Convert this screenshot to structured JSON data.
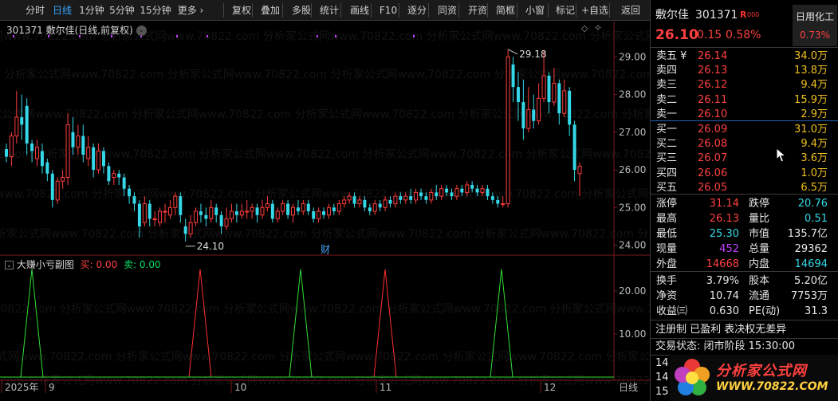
{
  "toolbar": {
    "items": [
      "分时",
      "日线",
      "1分钟",
      "5分钟",
      "15分钟",
      "更多 ›",
      "复权",
      "叠加",
      "多股",
      "统计",
      "画线",
      "F10",
      "逐分",
      "同资",
      "开资",
      "简框",
      "小窗",
      "标记",
      "+自选",
      "返回"
    ],
    "active_index": 1
  },
  "main_chart": {
    "title": "301371 敷尔佳(日线,前复权)",
    "high_label": "29.18",
    "low_label": "24.10",
    "event_label": "财",
    "y_ticks": [
      "29.00",
      "28.00",
      "27.00",
      "26.00",
      "25.00",
      "24.00"
    ],
    "watermark": "分析家公式网www.70822.com"
  },
  "sub_chart": {
    "title": "大赚小亏副图",
    "buy_label": "买: 0.00",
    "sell_label": "卖: 0.00",
    "y_ticks": [
      "20.00",
      "10.00"
    ]
  },
  "x_axis": {
    "labels": [
      "2025年",
      "9",
      "10",
      "11",
      "12"
    ],
    "period": "日线"
  },
  "colors": {
    "up": "#ff3c3c",
    "down": "#35d8e8",
    "buy_line": "#ff3030",
    "sell_line": "#30e030",
    "background": "#000000"
  },
  "chart_data": {
    "type": "candlestick",
    "ylim": [
      23.8,
      29.6
    ],
    "candles": [
      [
        26.55,
        26.35,
        26.7,
        26.2
      ],
      [
        26.35,
        26.9,
        27.0,
        26.1
      ],
      [
        26.9,
        27.4,
        28.1,
        26.7
      ],
      [
        27.4,
        27.2,
        28.0,
        26.8
      ],
      [
        27.7,
        26.7,
        27.9,
        26.4
      ],
      [
        26.7,
        26.5,
        26.8,
        26.2
      ],
      [
        26.3,
        26.6,
        26.8,
        26.1
      ],
      [
        26.5,
        26.1,
        26.7,
        25.9
      ],
      [
        26.2,
        25.9,
        26.3,
        25.7
      ],
      [
        25.9,
        25.2,
        26.0,
        25.0
      ],
      [
        25.2,
        25.7,
        25.8,
        25.1
      ],
      [
        25.7,
        25.8,
        26.0,
        25.5
      ],
      [
        25.8,
        27.2,
        27.5,
        25.6
      ],
      [
        27.0,
        26.6,
        27.4,
        26.4
      ],
      [
        26.6,
        26.9,
        27.2,
        26.4
      ],
      [
        26.9,
        26.4,
        27.2,
        26.2
      ],
      [
        26.3,
        26.6,
        26.9,
        26.1
      ],
      [
        26.6,
        26.0,
        26.7,
        25.8
      ],
      [
        26.0,
        26.5,
        26.7,
        25.9
      ],
      [
        26.5,
        26.1,
        26.6,
        25.9
      ],
      [
        26.1,
        25.7,
        26.2,
        25.6
      ],
      [
        25.8,
        25.9,
        26.0,
        25.6
      ],
      [
        25.9,
        25.8,
        26.0,
        25.6
      ],
      [
        25.8,
        25.5,
        25.9,
        25.3
      ],
      [
        25.5,
        25.3,
        25.6,
        25.1
      ],
      [
        25.3,
        25.1,
        25.4,
        24.9
      ],
      [
        25.1,
        24.5,
        25.2,
        24.2
      ],
      [
        24.6,
        25.1,
        25.3,
        24.5
      ],
      [
        25.1,
        24.7,
        25.2,
        24.5
      ],
      [
        24.7,
        24.7,
        24.9,
        24.5
      ],
      [
        24.6,
        24.9,
        25.0,
        24.5
      ],
      [
        24.9,
        24.9,
        25.1,
        24.6
      ],
      [
        24.8,
        25.0,
        25.2,
        24.7
      ],
      [
        25.0,
        25.3,
        25.4,
        24.8
      ],
      [
        25.3,
        24.8,
        25.4,
        24.6
      ],
      [
        24.5,
        24.3,
        24.7,
        24.1
      ],
      [
        24.3,
        24.6,
        24.8,
        24.2
      ],
      [
        24.6,
        24.9,
        25.0,
        24.5
      ],
      [
        24.9,
        24.8,
        25.1,
        24.6
      ],
      [
        24.8,
        24.7,
        25.0,
        24.5
      ],
      [
        24.7,
        25.0,
        25.2,
        24.6
      ],
      [
        25.0,
        24.8,
        25.1,
        24.6
      ],
      [
        24.8,
        24.5,
        24.9,
        24.3
      ],
      [
        24.5,
        24.7,
        25.0,
        24.4
      ],
      [
        24.7,
        24.9,
        25.1,
        24.6
      ],
      [
        24.9,
        24.8,
        25.1,
        24.6
      ],
      [
        24.8,
        24.9,
        25.1,
        24.7
      ],
      [
        24.9,
        24.9,
        25.2,
        24.7
      ],
      [
        24.9,
        25.0,
        25.1,
        24.7
      ],
      [
        25.0,
        24.8,
        25.1,
        24.6
      ],
      [
        24.8,
        25.0,
        25.2,
        24.7
      ],
      [
        25.0,
        25.1,
        25.3,
        24.9
      ],
      [
        25.1,
        24.7,
        25.2,
        24.6
      ],
      [
        24.7,
        24.9,
        25.0,
        24.6
      ],
      [
        24.9,
        25.1,
        25.2,
        24.8
      ],
      [
        25.1,
        24.8,
        25.2,
        24.7
      ],
      [
        24.8,
        25.0,
        25.1,
        24.6
      ],
      [
        25.0,
        24.9,
        25.2,
        24.8
      ],
      [
        24.9,
        25.1,
        25.2,
        24.8
      ],
      [
        25.1,
        24.9,
        25.2,
        24.8
      ],
      [
        24.9,
        24.7,
        25.0,
        24.6
      ],
      [
        24.7,
        24.9,
        25.0,
        24.6
      ],
      [
        24.9,
        24.8,
        25.0,
        24.7
      ],
      [
        24.8,
        25.0,
        25.1,
        24.7
      ],
      [
        25.0,
        24.9,
        25.1,
        24.8
      ],
      [
        24.9,
        25.1,
        25.2,
        24.8
      ],
      [
        25.1,
        25.2,
        25.3,
        25.0
      ],
      [
        25.2,
        25.3,
        25.4,
        25.1
      ],
      [
        25.3,
        25.1,
        25.4,
        25.0
      ],
      [
        25.1,
        25.2,
        25.3,
        25.0
      ],
      [
        25.2,
        25.0,
        25.3,
        24.9
      ],
      [
        25.0,
        24.9,
        25.1,
        24.8
      ],
      [
        24.9,
        25.1,
        25.2,
        24.8
      ],
      [
        25.1,
        25.0,
        25.2,
        24.9
      ],
      [
        25.0,
        25.2,
        25.3,
        24.9
      ],
      [
        25.2,
        25.1,
        25.3,
        25.0
      ],
      [
        25.1,
        25.3,
        25.4,
        25.0
      ],
      [
        25.3,
        25.2,
        25.4,
        25.1
      ],
      [
        25.2,
        25.3,
        25.4,
        25.1
      ],
      [
        25.3,
        25.2,
        25.5,
        25.1
      ],
      [
        25.2,
        25.4,
        25.5,
        25.1
      ],
      [
        25.4,
        25.3,
        25.5,
        25.2
      ],
      [
        25.3,
        25.2,
        25.4,
        25.1
      ],
      [
        25.2,
        25.4,
        25.5,
        25.1
      ],
      [
        25.4,
        25.3,
        25.6,
        25.2
      ],
      [
        25.3,
        25.5,
        25.6,
        25.2
      ],
      [
        25.5,
        25.4,
        25.6,
        25.3
      ],
      [
        25.4,
        25.3,
        25.5,
        25.2
      ],
      [
        25.3,
        25.5,
        25.6,
        25.2
      ],
      [
        25.5,
        25.4,
        25.6,
        25.3
      ],
      [
        25.4,
        25.6,
        25.7,
        25.3
      ],
      [
        25.6,
        25.5,
        25.7,
        25.4
      ],
      [
        25.5,
        25.4,
        25.6,
        25.3
      ],
      [
        25.4,
        25.5,
        25.6,
        25.3
      ],
      [
        25.5,
        25.3,
        25.6,
        25.2
      ],
      [
        25.3,
        25.2,
        25.4,
        25.1
      ],
      [
        25.2,
        25.1,
        25.3,
        25.0
      ],
      [
        25.1,
        25.1,
        25.3,
        25.0
      ],
      [
        25.1,
        29.0,
        29.2,
        25.0
      ],
      [
        28.8,
        28.2,
        29.0,
        27.8
      ],
      [
        28.2,
        27.8,
        28.6,
        27.3
      ],
      [
        27.8,
        27.1,
        28.4,
        26.8
      ],
      [
        27.1,
        27.6,
        28.2,
        27.0
      ],
      [
        27.6,
        27.3,
        28.0,
        27.1
      ],
      [
        27.3,
        27.9,
        28.3,
        27.2
      ],
      [
        27.9,
        28.5,
        29.18,
        27.8
      ],
      [
        28.5,
        27.8,
        28.6,
        27.5
      ],
      [
        27.8,
        28.3,
        28.7,
        27.7
      ],
      [
        28.3,
        27.5,
        28.4,
        27.2
      ],
      [
        27.5,
        28.1,
        28.4,
        27.4
      ],
      [
        28.1,
        27.2,
        28.2,
        26.9
      ],
      [
        27.2,
        26.0,
        27.3,
        25.7
      ],
      [
        25.9,
        26.1,
        26.2,
        25.3
      ]
    ],
    "buy_peaks": [
      48,
      97,
      148,
      193,
      246
    ],
    "sell_peaks": [
      80,
      120,
      170,
      220,
      270
    ]
  },
  "panel": {
    "name": "敷尔佳",
    "code": "301371",
    "tag": "R",
    "tag_sub": "000",
    "sector": "日用化工",
    "sector_change": "0.73%",
    "price": "26.10",
    "change": "0.15",
    "change_pct": "0.58%",
    "asks": [
      {
        "label": "卖五 ¥",
        "price": "26.14",
        "vol": "34.0万"
      },
      {
        "label": "卖四",
        "price": "26.13",
        "vol": "13.8万"
      },
      {
        "label": "卖三",
        "price": "26.12",
        "vol": "9.4万"
      },
      {
        "label": "卖二",
        "price": "26.11",
        "vol": "15.9万"
      },
      {
        "label": "卖一",
        "price": "26.10",
        "vol": "2.9万"
      }
    ],
    "bids": [
      {
        "label": "买一",
        "price": "26.09",
        "vol": "31.0万"
      },
      {
        "label": "买二",
        "price": "26.08",
        "vol": "9.4万"
      },
      {
        "label": "买三",
        "price": "26.07",
        "vol": "3.6万"
      },
      {
        "label": "买四",
        "price": "26.06",
        "vol": "1.0万"
      },
      {
        "label": "买五",
        "price": "26.05",
        "vol": "6.5万"
      }
    ],
    "stats": [
      {
        "l1": "涨停",
        "v1": "31.14",
        "c1": "red",
        "l2": "跌停",
        "v2": "20.76",
        "c2": "cyan"
      },
      {
        "l1": "最高",
        "v1": "26.13",
        "c1": "red",
        "l2": "量比",
        "v2": "0.51",
        "c2": "cyan"
      },
      {
        "l1": "最低",
        "v1": "25.30",
        "c1": "cyan",
        "l2": "市值",
        "v2": "135.7亿",
        "c2": "white"
      },
      {
        "l1": "现量",
        "v1": "452",
        "c1": "purple",
        "l2": "总量",
        "v2": "29362",
        "c2": "white"
      },
      {
        "l1": "外盘",
        "v1": "14668",
        "c1": "red",
        "l2": "内盘",
        "v2": "14694",
        "c2": "cyan"
      }
    ],
    "stats2": [
      {
        "l1": "换手",
        "v1": "3.79%",
        "l2": "股本",
        "v2": "5.20亿"
      },
      {
        "l1": "净资",
        "v1": "10.74",
        "l2": "流通",
        "v2": "7753万"
      },
      {
        "l1": "收益㈢",
        "v1": "0.630",
        "l2": "PE(动)",
        "v2": "31.3"
      }
    ],
    "note": "注册制 已盈利 表决权无差异",
    "status": "交易状态: 闭市阶段 15:30:00",
    "times": [
      "14",
      "14",
      "15"
    ],
    "logo_text": "分析家公式网",
    "logo_url": "WWW.70822.COM"
  }
}
